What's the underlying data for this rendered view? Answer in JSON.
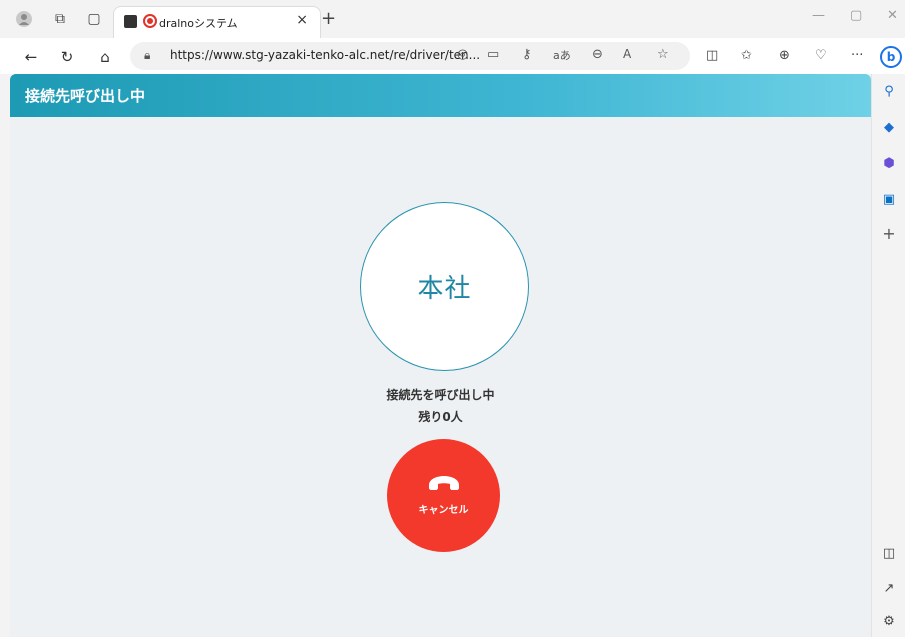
{
  "browser": {
    "tab_title": "dralnoシステム",
    "url": "https://www.stg-yazaki-tenko-alc.net/re/driver/ten..."
  },
  "page": {
    "header_title": "接続先呼び出し中",
    "callee_name": "本社",
    "status_text": "接続先を呼び出し中",
    "remaining_text": "残り0人",
    "cancel_label": "キャンセル"
  },
  "icons": {
    "hangup": "phone-hangup-icon",
    "accent_red": "#f2392b",
    "accent_teal": "#1f86a4"
  }
}
